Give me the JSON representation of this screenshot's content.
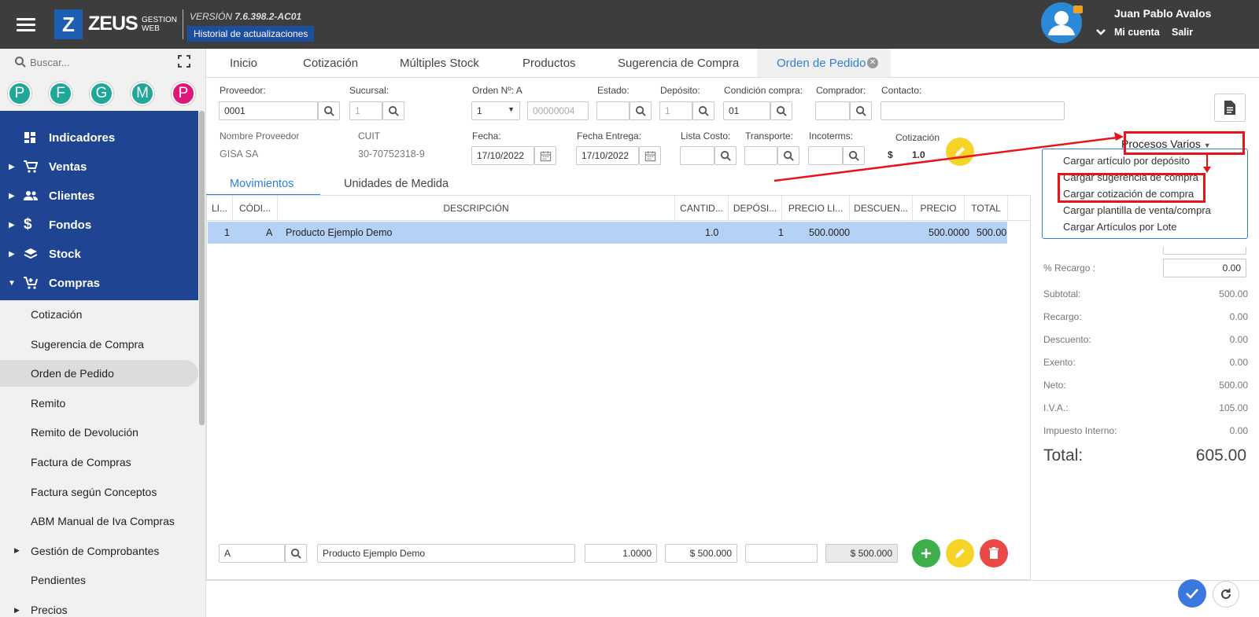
{
  "header": {
    "logo_letter": "Z",
    "brand": "ZEUS",
    "brand_sub1": "GESTION",
    "brand_sub2": "WEB",
    "version_label": "VERSIÓN",
    "version_number": "7.6.398.2-AC01",
    "history_button": "Historial de actualizaciones",
    "user_name": "Juan Pablo Avalos",
    "my_account": "Mi cuenta",
    "logout": "Salir"
  },
  "sidebar": {
    "search_placeholder": "Buscar...",
    "quick_avatars": [
      {
        "letter": "P",
        "color": "#1fa79a"
      },
      {
        "letter": "F",
        "color": "#1fa79a"
      },
      {
        "letter": "G",
        "color": "#1fa79a"
      },
      {
        "letter": "M",
        "color": "#1fa79a"
      },
      {
        "letter": "P",
        "color": "#e0177b"
      }
    ],
    "nav": [
      "Indicadores",
      "Ventas",
      "Clientes",
      "Fondos",
      "Stock",
      "Compras"
    ],
    "compras_items": [
      "Cotización",
      "Sugerencia de Compra",
      "Orden de Pedido",
      "Remito",
      "Remito de Devolución",
      "Factura de Compras",
      "Factura según Conceptos",
      "ABM Manual de Iva Compras",
      "Gestión de Comprobantes",
      "Pendientes",
      "Precios"
    ],
    "nav_bg": "#1f4492"
  },
  "tabs": [
    "Inicio",
    "Cotización",
    "Múltiples Stock",
    "Productos",
    "Sugerencia de Compra",
    "Orden de Pedido"
  ],
  "form": {
    "proveedor_label": "Proveedor:",
    "proveedor_value": "0001",
    "sucursal_label": "Sucursal:",
    "sucursal_value": "1",
    "orden_label": "Orden Nº: A",
    "orden_select": "1",
    "orden_number": "00000004",
    "estado_label": "Estado:",
    "deposito_label": "Depósito:",
    "deposito_value": "1",
    "condicion_label": "Condición compra:",
    "condicion_value": "01",
    "comprador_label": "Comprador:",
    "contacto_label": "Contacto:",
    "nombre_label": "Nombre Proveedor",
    "nombre_value": "GISA SA",
    "cuit_label": "CUIT",
    "cuit_value": "30-70752318-9",
    "fecha_label": "Fecha:",
    "fecha_value": "17/10/2022",
    "fecha_entrega_label": "Fecha Entrega:",
    "fecha_entrega_value": "17/10/2022",
    "lista_costo_label": "Lista Costo:",
    "transporte_label": "Transporte:",
    "incoterms_label": "Incoterms:",
    "cotizacion_label": "Cotización",
    "cotizacion_currency": "$",
    "cotizacion_value": "1.0"
  },
  "procesos": {
    "label": "Procesos Varios",
    "items": [
      "Cargar artículo por depósito",
      "Cargar sugerencia de compra",
      "Cargar cotización de compra",
      "Cargar plantilla de venta/compra",
      "Cargar Artículos por Lote"
    ]
  },
  "subtabs": [
    "Movimientos",
    "Unidades de Medida"
  ],
  "table": {
    "headers": [
      "LI...",
      "CÓDI...",
      "DESCRIPCIÓN",
      "CANTID...",
      "DEPÓSI...",
      "PRECIO LI...",
      "DESCUEN...",
      "PRECIO",
      "TOTAL"
    ],
    "rows": [
      [
        "1",
        "A",
        "Producto Ejemplo Demo",
        "1.0",
        "1",
        "500.0000",
        "",
        "500.0000",
        "500.00"
      ]
    ]
  },
  "totals": {
    "recargo_label": "% Recargo :",
    "recargo_value": "0.00",
    "rows": [
      {
        "label": "Subtotal:",
        "value": "500.00"
      },
      {
        "label": "Recargo:",
        "value": "0.00"
      },
      {
        "label": "Descuento:",
        "value": "0.00"
      },
      {
        "label": "Exento:",
        "value": "0.00"
      },
      {
        "label": "Neto:",
        "value": "500.00"
      },
      {
        "label": "I.V.A.:",
        "value": "105.00"
      },
      {
        "label": "Impuesto Interno:",
        "value": "0.00"
      }
    ],
    "total_label": "Total:",
    "total_value": "605.00"
  },
  "entry": {
    "code": "A",
    "description": "Producto Ejemplo Demo",
    "quantity": "1.0000",
    "price": "$ 500.000",
    "discount": "",
    "total": "$ 500.000"
  },
  "colors": {
    "accent": "#2f7fd8",
    "annotation": "#e8141b",
    "add": "#3dae4a",
    "edit": "#f5d327",
    "delete": "#e94a45",
    "confirm": "#3a78e0",
    "selected_row": "#b5d1f5"
  }
}
